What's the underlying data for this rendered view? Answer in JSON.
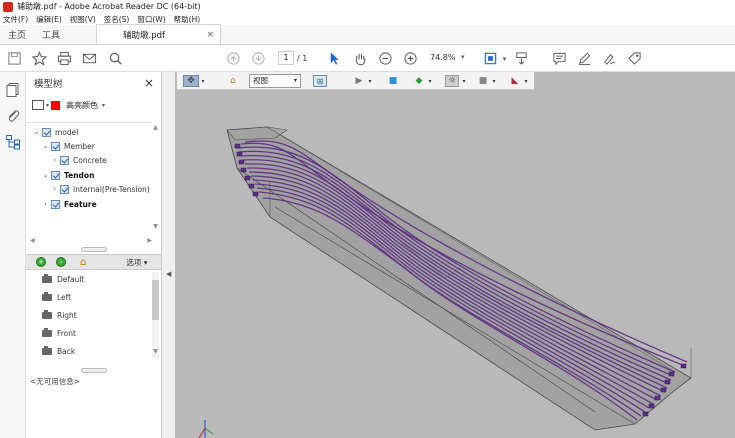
{
  "window": {
    "title": "辅助墩.pdf - Adobe Acrobat Reader DC (64-bit)"
  },
  "menu": [
    "文件(F)",
    "编辑(E)",
    "视图(V)",
    "签名(S)",
    "窗口(W)",
    "帮助(H)"
  ],
  "tabs": {
    "home": "主页",
    "tools": "工具",
    "document": "辅助墩.pdf",
    "close": "×"
  },
  "toolbar": {
    "page_current": "1",
    "page_total": "/ 1",
    "zoom": "74.8%"
  },
  "model_tree": {
    "title": "模型树",
    "close": "×",
    "highlight_label": "高亮颜色",
    "highlight_color": "#ff0000",
    "nodes": [
      {
        "label": "model",
        "expanded": true,
        "bold": false
      },
      {
        "label": "Member",
        "expanded": true,
        "bold": false
      },
      {
        "label": "Concrete",
        "expanded": false,
        "bold": false
      },
      {
        "label": "Tendon",
        "expanded": true,
        "bold": true
      },
      {
        "label": "Internal(Pre-Tension)",
        "expanded": false,
        "bold": false
      },
      {
        "label": "Feature",
        "expanded": false,
        "bold": true
      }
    ]
  },
  "views_panel": {
    "options_label": "选项",
    "views": [
      "Default",
      "Left",
      "Right",
      "Front",
      "Back"
    ],
    "no_info": "<无可用信息>"
  },
  "viewer3d": {
    "view_select": "视图"
  },
  "colors": {
    "tendon": "#5b2c83",
    "viewport_bg": "#b9b9b9",
    "check_blue": "#1d5fb0"
  }
}
